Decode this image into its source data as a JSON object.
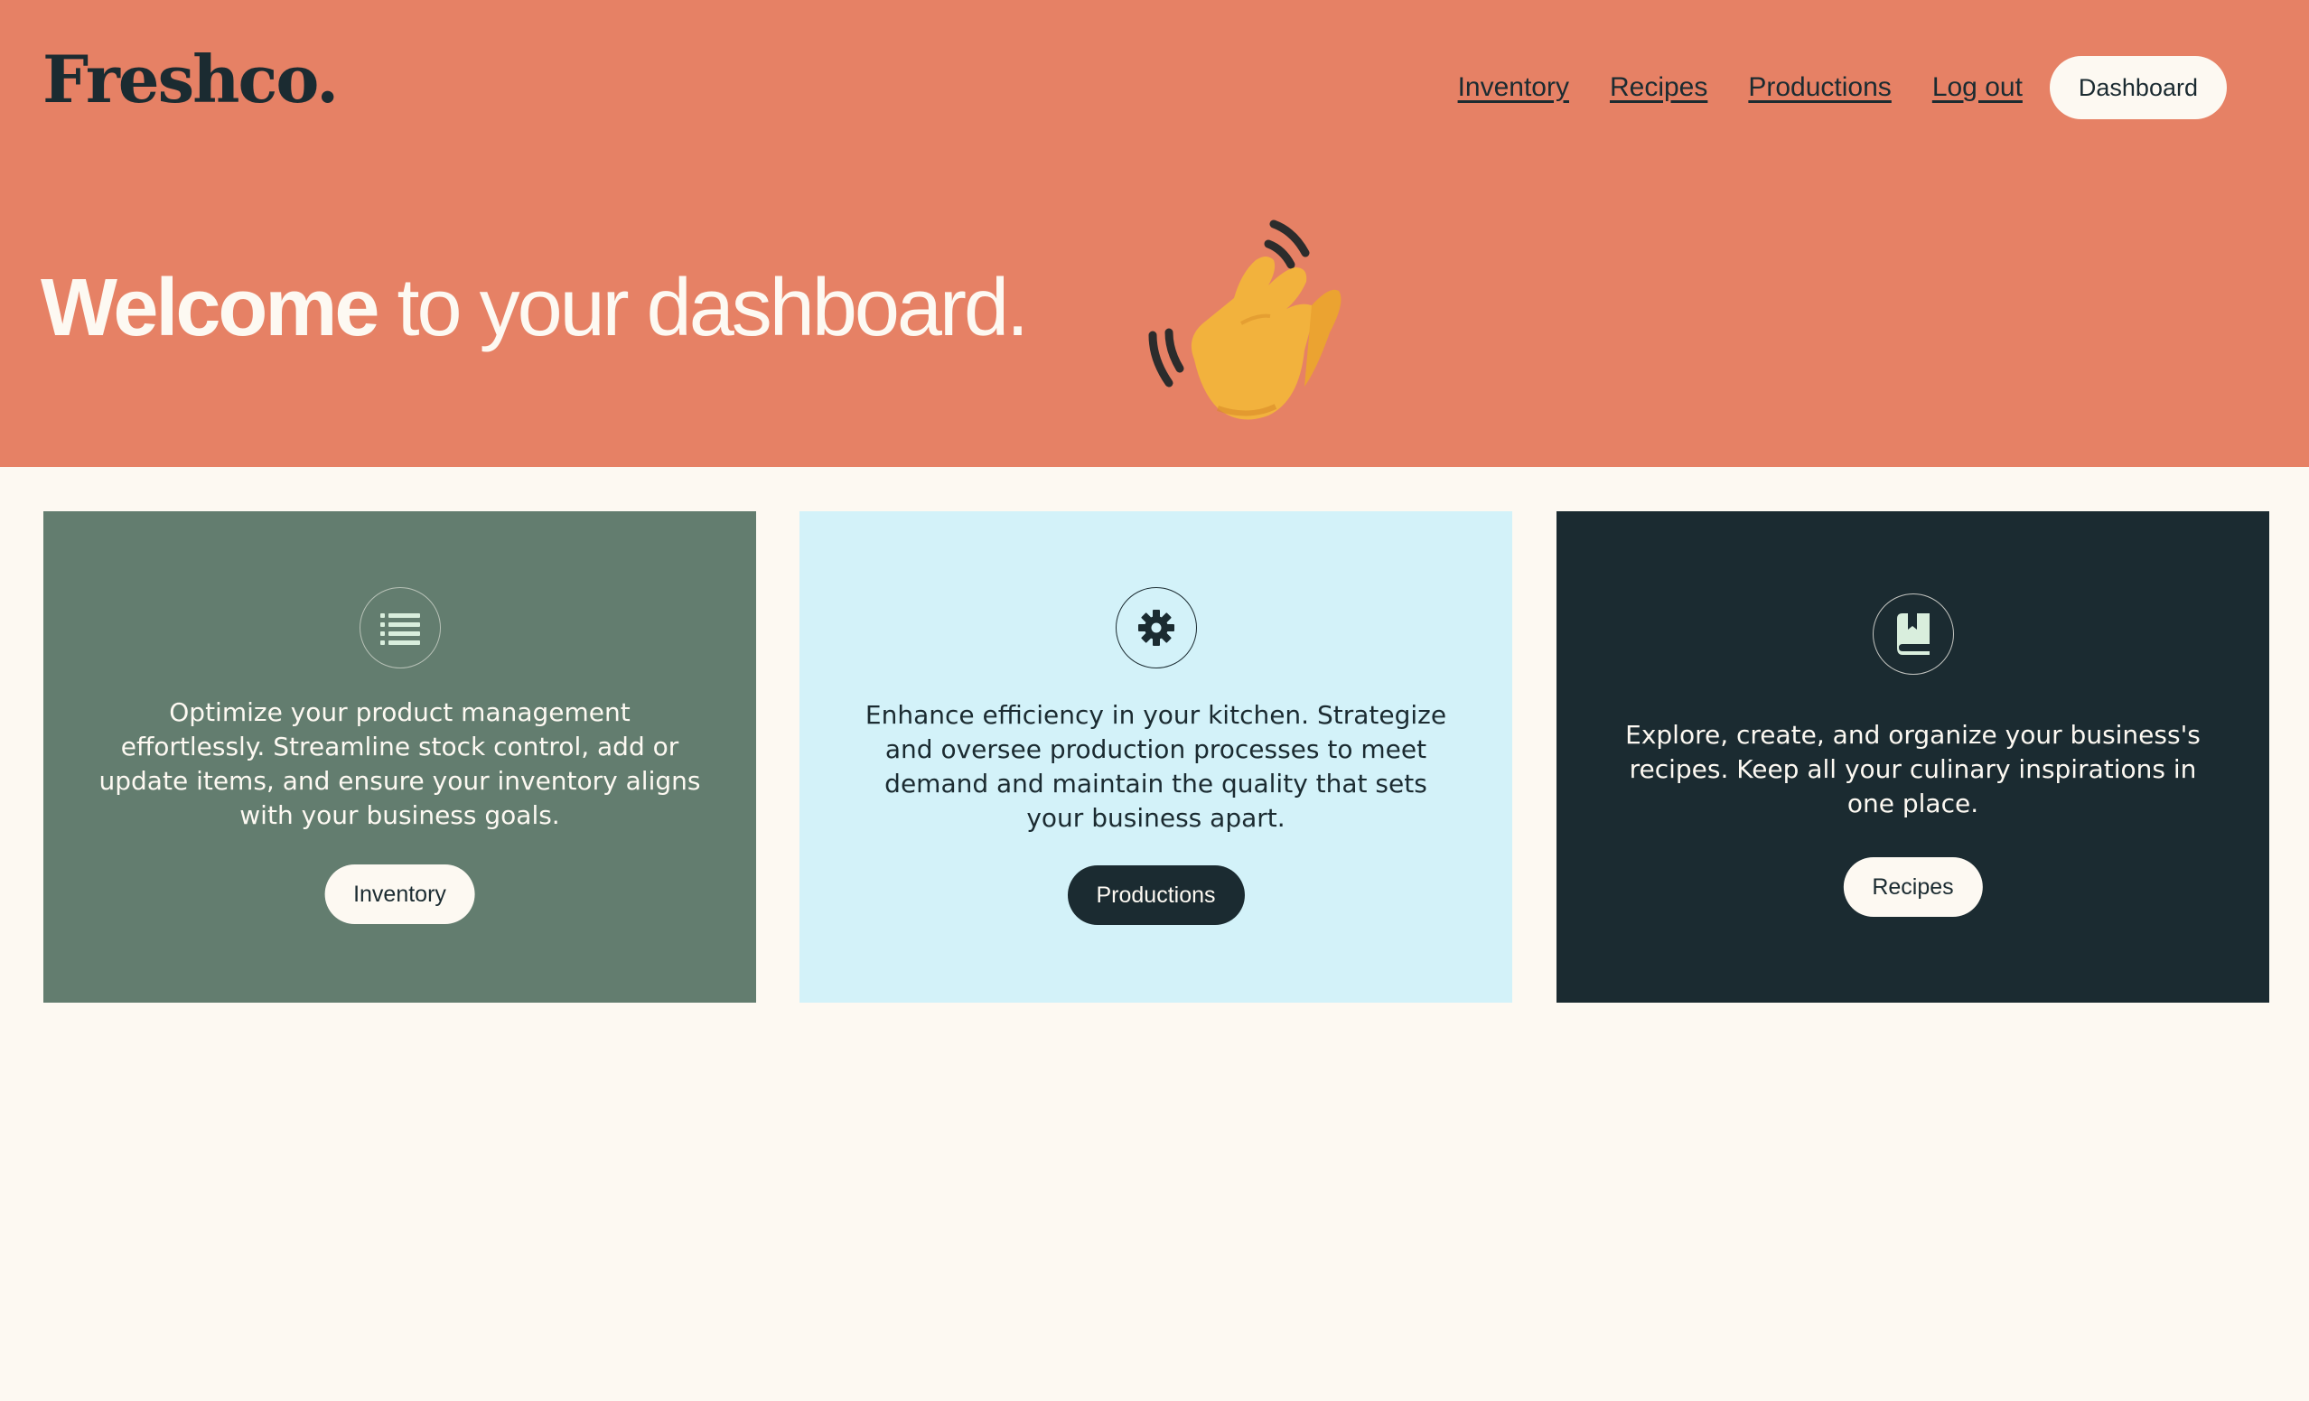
{
  "header": {
    "logo": "Freshco.",
    "nav": [
      {
        "label": "Inventory"
      },
      {
        "label": "Recipes"
      },
      {
        "label": "Productions"
      },
      {
        "label": "Log out"
      }
    ],
    "dashboard_button": "Dashboard"
  },
  "hero": {
    "title_bold": "Welcome",
    "title_rest": " to your dashboard.",
    "emoji_icon": "waving-hand-icon"
  },
  "cards": [
    {
      "icon": "list-icon",
      "text": "Optimize your product management effortlessly. Streamline stock control, add or update items, and ensure your inventory aligns with your business goals.",
      "button": "Inventory"
    },
    {
      "icon": "gear-icon",
      "text": "Enhance efficiency in your kitchen. Strategize and oversee production processes to meet demand and maintain the quality that sets your business apart.",
      "button": "Productions"
    },
    {
      "icon": "book-bookmark-icon",
      "text": "Explore, create, and organize your business's recipes. Keep all your culinary inspirations in one place.",
      "button": "Recipes"
    }
  ],
  "colors": {
    "hero_bg": "#e68165",
    "page_bg": "#fdf9f2",
    "dark": "#1b2b31",
    "sage": "#637d6f",
    "light_blue": "#d3f2f9",
    "icon_mint": "#d9eedd"
  }
}
